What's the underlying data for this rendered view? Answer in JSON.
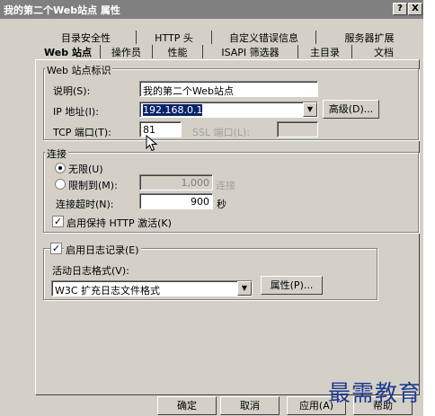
{
  "window": {
    "title": "我的第二个Web站点 属性",
    "help_btn": "?",
    "close_btn": "X"
  },
  "tabs": {
    "row1": [
      "目录安全性",
      "HTTP 头",
      "自定义错误信息",
      "服务器扩展"
    ],
    "row2": [
      "Web 站点",
      "操作员",
      "性能",
      "ISAPI 筛选器",
      "主目录",
      "文档"
    ]
  },
  "site_id": {
    "legend": "Web 站点标识",
    "desc_label": "说明(S):",
    "desc_value": "我的第二个Web站点",
    "ip_label": "IP 地址(I):",
    "ip_value": "192.168.0.1",
    "advanced_btn": "高级(D)...",
    "tcp_label": "TCP 端口(T):",
    "tcp_value": "81",
    "ssl_label": "SSL 端口(L):",
    "ssl_value": ""
  },
  "connection": {
    "legend": "连接",
    "unlimited": "无限(U)",
    "limited": "限制到(M):",
    "limit_value": "1,000",
    "limit_unit": "连接",
    "timeout_label": "连接超时(N):",
    "timeout_value": "900",
    "timeout_unit": "秒",
    "keepalive": "启用保持 HTTP 激活(K)"
  },
  "logging": {
    "enable": "启用日志记录(E)",
    "format_label": "活动日志格式(V):",
    "format_value": "W3C 扩充日志文件格式",
    "props_btn": "属性(P)..."
  },
  "footer": {
    "ok": "确定",
    "cancel": "取消",
    "apply": "应用(A)",
    "help": "帮助"
  },
  "watermark": "最需教育"
}
